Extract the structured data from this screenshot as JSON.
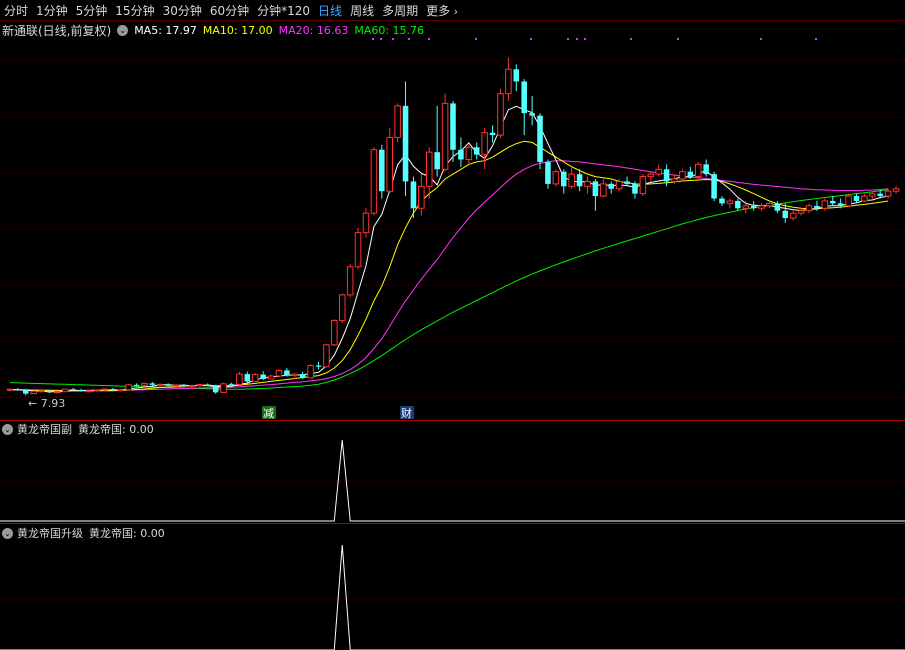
{
  "tabs": [
    {
      "label": "分时",
      "active": false
    },
    {
      "label": "1分钟",
      "active": false
    },
    {
      "label": "5分钟",
      "active": false
    },
    {
      "label": "15分钟",
      "active": false
    },
    {
      "label": "30分钟",
      "active": false
    },
    {
      "label": "60分钟",
      "active": false
    },
    {
      "label": "分钟*120",
      "active": false
    },
    {
      "label": "日线",
      "active": true
    },
    {
      "label": "周线",
      "active": false
    },
    {
      "label": "多周期",
      "active": false
    },
    {
      "label": "更多",
      "active": false
    }
  ],
  "more_icon": "chevron-right-icon",
  "stock": {
    "title": "新通联(日线,前复权)"
  },
  "ma": [
    {
      "label": "MA5: 17.97",
      "color": "#ffffff"
    },
    {
      "label": "MA10: 17.00",
      "color": "#ffff00"
    },
    {
      "label": "MA20: 16.63",
      "color": "#ff33ff"
    },
    {
      "label": "MA60: 15.76",
      "color": "#00ee00"
    }
  ],
  "markers": {
    "low_label": "← 7.93",
    "event1": "减",
    "event2": "财"
  },
  "panel2": {
    "name": "黄龙帝国副",
    "value_label": "黄龙帝国: 0.00"
  },
  "panel3": {
    "name": "黄龙帝国升级",
    "value_label": "黄龙帝国: 0.00"
  },
  "colors": {
    "up": "#ff3232",
    "down": "#54ffff",
    "ma5": "#ffffff",
    "ma10": "#ffff00",
    "ma20": "#ff33ff",
    "ma60": "#00ee00",
    "grid": "#7a0000",
    "active_tab": "#3fa6ff"
  },
  "chart_data": {
    "type": "candlestick",
    "ylim": [
      7.0,
      22.5
    ],
    "grid": "dotted",
    "ohlc": [
      [
        8.16,
        8.21,
        8.1,
        8.18
      ],
      [
        8.18,
        8.23,
        8.12,
        8.14
      ],
      [
        8.14,
        8.18,
        7.93,
        8.0
      ],
      [
        8.0,
        8.12,
        7.98,
        8.1
      ],
      [
        8.1,
        8.18,
        8.05,
        8.12
      ],
      [
        8.12,
        8.16,
        8.02,
        8.05
      ],
      [
        8.05,
        8.11,
        8.0,
        8.08
      ],
      [
        8.08,
        8.2,
        8.06,
        8.18
      ],
      [
        8.18,
        8.24,
        8.1,
        8.15
      ],
      [
        8.15,
        8.2,
        8.08,
        8.1
      ],
      [
        8.1,
        8.15,
        8.05,
        8.12
      ],
      [
        8.12,
        8.17,
        8.08,
        8.15
      ],
      [
        8.15,
        8.21,
        8.12,
        8.19
      ],
      [
        8.19,
        8.23,
        8.1,
        8.13
      ],
      [
        8.13,
        8.18,
        8.09,
        8.16
      ],
      [
        8.16,
        8.4,
        8.14,
        8.36
      ],
      [
        8.36,
        8.42,
        8.3,
        8.34
      ],
      [
        8.34,
        8.45,
        8.28,
        8.42
      ],
      [
        8.42,
        8.48,
        8.32,
        8.36
      ],
      [
        8.36,
        8.41,
        8.3,
        8.38
      ],
      [
        8.38,
        8.42,
        8.3,
        8.32
      ],
      [
        8.32,
        8.38,
        8.25,
        8.35
      ],
      [
        8.35,
        8.4,
        8.28,
        8.3
      ],
      [
        8.3,
        8.36,
        8.24,
        8.33
      ],
      [
        8.33,
        8.4,
        8.29,
        8.37
      ],
      [
        8.37,
        8.42,
        8.3,
        8.32
      ],
      [
        8.32,
        8.36,
        8.0,
        8.05
      ],
      [
        8.05,
        8.45,
        8.03,
        8.4
      ],
      [
        8.4,
        8.44,
        8.36,
        8.38
      ],
      [
        8.38,
        8.9,
        8.3,
        8.8
      ],
      [
        8.8,
        8.9,
        8.4,
        8.5
      ],
      [
        8.5,
        8.85,
        8.48,
        8.78
      ],
      [
        8.78,
        8.92,
        8.55,
        8.6
      ],
      [
        8.6,
        8.78,
        8.58,
        8.72
      ],
      [
        8.72,
        9.0,
        8.7,
        8.95
      ],
      [
        8.95,
        9.05,
        8.7,
        8.74
      ],
      [
        8.74,
        8.85,
        8.6,
        8.8
      ],
      [
        8.8,
        8.9,
        8.6,
        8.65
      ],
      [
        8.65,
        9.2,
        8.62,
        9.15
      ],
      [
        9.15,
        9.3,
        9.0,
        9.1
      ],
      [
        9.1,
        10.05,
        9.08,
        10.0
      ],
      [
        10.0,
        11.05,
        9.95,
        11.0
      ],
      [
        11.0,
        12.1,
        10.9,
        12.05
      ],
      [
        12.05,
        13.3,
        11.95,
        13.2
      ],
      [
        13.2,
        14.8,
        13.1,
        14.6
      ],
      [
        14.6,
        15.6,
        14.4,
        15.4
      ],
      [
        15.4,
        18.1,
        15.3,
        18.0
      ],
      [
        18.0,
        18.2,
        16.0,
        16.3
      ],
      [
        16.3,
        18.9,
        16.2,
        18.5
      ],
      [
        18.5,
        19.9,
        18.3,
        19.8
      ],
      [
        19.8,
        20.8,
        16.1,
        16.7
      ],
      [
        16.7,
        16.9,
        15.2,
        15.6
      ],
      [
        15.6,
        17.0,
        15.3,
        16.5
      ],
      [
        16.5,
        18.1,
        16.0,
        17.9
      ],
      [
        17.9,
        19.8,
        16.9,
        17.2
      ],
      [
        17.2,
        20.3,
        17.1,
        19.9
      ],
      [
        19.9,
        20.0,
        17.5,
        18.0
      ],
      [
        18.0,
        18.5,
        17.3,
        17.6
      ],
      [
        17.6,
        18.2,
        17.4,
        18.1
      ],
      [
        18.1,
        18.3,
        17.6,
        17.8
      ],
      [
        17.8,
        18.9,
        17.2,
        18.7
      ],
      [
        18.7,
        19.0,
        18.3,
        18.6
      ],
      [
        18.6,
        20.5,
        18.5,
        20.3
      ],
      [
        20.3,
        21.8,
        20.0,
        21.3
      ],
      [
        21.3,
        21.5,
        20.4,
        20.8
      ],
      [
        20.8,
        20.9,
        18.6,
        19.5
      ],
      [
        19.5,
        20.2,
        19.0,
        19.4
      ],
      [
        19.4,
        19.5,
        17.2,
        17.5
      ],
      [
        17.5,
        17.6,
        16.4,
        16.6
      ],
      [
        16.6,
        17.2,
        16.5,
        17.1
      ],
      [
        17.1,
        17.2,
        16.2,
        16.5
      ],
      [
        16.5,
        17.3,
        16.4,
        17.0
      ],
      [
        17.0,
        17.2,
        16.3,
        16.5
      ],
      [
        16.5,
        16.9,
        16.2,
        16.7
      ],
      [
        16.7,
        16.8,
        15.5,
        16.1
      ],
      [
        16.1,
        16.8,
        16.05,
        16.6
      ],
      [
        16.6,
        16.7,
        16.2,
        16.4
      ],
      [
        16.4,
        16.8,
        16.3,
        16.7
      ],
      [
        16.7,
        16.9,
        16.5,
        16.6
      ],
      [
        16.6,
        16.7,
        16.0,
        16.2
      ],
      [
        16.2,
        17.0,
        16.1,
        16.9
      ],
      [
        16.9,
        17.1,
        16.7,
        17.0
      ],
      [
        17.0,
        17.4,
        16.9,
        17.2
      ],
      [
        17.2,
        17.4,
        16.5,
        16.7
      ],
      [
        16.7,
        17.0,
        16.6,
        16.8
      ],
      [
        16.8,
        17.2,
        16.7,
        17.1
      ],
      [
        17.1,
        17.3,
        16.8,
        16.9
      ],
      [
        16.9,
        17.5,
        16.8,
        17.4
      ],
      [
        17.4,
        17.6,
        16.9,
        17.0
      ],
      [
        17.0,
        17.1,
        15.9,
        16.0
      ],
      [
        16.0,
        16.1,
        15.7,
        15.8
      ],
      [
        15.8,
        16.0,
        15.6,
        15.9
      ],
      [
        15.9,
        16.0,
        15.5,
        15.6
      ],
      [
        15.6,
        15.9,
        15.4,
        15.7
      ],
      [
        15.7,
        15.9,
        15.5,
        15.6
      ],
      [
        15.6,
        15.8,
        15.5,
        15.7
      ],
      [
        15.7,
        15.9,
        15.6,
        15.8
      ],
      [
        15.8,
        15.9,
        15.4,
        15.5
      ],
      [
        15.5,
        15.8,
        15.0,
        15.2
      ],
      [
        15.2,
        15.5,
        15.1,
        15.4
      ],
      [
        15.4,
        15.6,
        15.3,
        15.5
      ],
      [
        15.5,
        15.8,
        15.4,
        15.7
      ],
      [
        15.7,
        15.9,
        15.5,
        15.6
      ],
      [
        15.6,
        16.0,
        15.5,
        15.9
      ],
      [
        15.9,
        16.1,
        15.7,
        15.8
      ],
      [
        15.8,
        16.0,
        15.6,
        15.7
      ],
      [
        15.7,
        16.2,
        15.65,
        16.1
      ],
      [
        16.1,
        16.2,
        15.8,
        15.9
      ],
      [
        15.9,
        16.2,
        15.85,
        16.1
      ],
      [
        16.1,
        16.3,
        15.95,
        16.2
      ],
      [
        16.2,
        16.35,
        16.0,
        16.1
      ],
      [
        16.1,
        16.4,
        16.0,
        16.3
      ],
      [
        16.3,
        16.5,
        16.2,
        16.4
      ]
    ],
    "ma5": [
      8.16,
      8.16,
      8.14,
      8.12,
      8.1,
      8.08,
      8.08,
      8.1,
      8.12,
      8.12,
      8.13,
      8.14,
      8.15,
      8.15,
      8.15,
      8.2,
      8.23,
      8.27,
      8.3,
      8.37,
      8.36,
      8.35,
      8.34,
      8.33,
      8.33,
      8.33,
      8.28,
      8.29,
      8.3,
      8.39,
      8.43,
      8.57,
      8.64,
      8.69,
      8.71,
      8.76,
      8.76,
      8.77,
      8.82,
      8.87,
      9.14,
      9.58,
      10.26,
      11.07,
      12.17,
      13.25,
      14.85,
      15.35,
      16.33,
      17.38,
      17.8,
      17.32,
      17.03,
      16.9,
      16.56,
      17.33,
      17.72,
      17.95,
      18.28,
      17.88,
      17.64,
      18.16,
      18.92,
      19.64,
      19.78,
      19.64,
      19.52,
      18.96,
      18.26,
      17.59,
      16.86,
      16.73,
      16.66,
      16.71,
      16.53,
      16.58,
      16.52,
      16.56,
      16.53,
      16.46,
      16.58,
      16.66,
      16.72,
      16.78,
      16.8,
      16.91,
      16.86,
      17.05,
      17.12,
      16.88,
      16.64,
      16.38,
      16.05,
      15.8,
      15.72,
      15.71,
      15.71,
      15.64,
      15.6,
      15.54,
      15.51,
      15.56,
      15.57,
      15.68,
      15.7,
      15.71,
      15.78,
      15.82,
      15.92,
      15.94,
      16.04,
      16.1
    ],
    "ma10": [
      8.16,
      8.16,
      8.15,
      8.14,
      8.13,
      8.12,
      8.12,
      8.12,
      8.12,
      8.12,
      8.12,
      8.12,
      8.12,
      8.12,
      8.13,
      8.15,
      8.17,
      8.19,
      8.22,
      8.25,
      8.27,
      8.29,
      8.31,
      8.33,
      8.34,
      8.35,
      8.32,
      8.32,
      8.32,
      8.35,
      8.38,
      8.42,
      8.46,
      8.5,
      8.54,
      8.58,
      8.62,
      8.66,
      8.7,
      8.74,
      8.85,
      9.05,
      9.35,
      9.8,
      10.4,
      11.05,
      11.8,
      12.4,
      13.2,
      14.1,
      14.8,
      15.4,
      15.9,
      16.2,
      16.45,
      16.8,
      17.0,
      17.2,
      17.4,
      17.5,
      17.55,
      17.7,
      17.9,
      18.1,
      18.25,
      18.35,
      18.3,
      18.1,
      17.9,
      17.7,
      17.5,
      17.3,
      17.15,
      17.0,
      16.9,
      16.85,
      16.8,
      16.7,
      16.65,
      16.6,
      16.58,
      16.6,
      16.62,
      16.65,
      16.68,
      16.72,
      16.74,
      16.76,
      16.78,
      16.76,
      16.7,
      16.6,
      16.48,
      16.35,
      16.2,
      16.05,
      15.9,
      15.78,
      15.7,
      15.64,
      15.6,
      15.58,
      15.58,
      15.6,
      15.62,
      15.65,
      15.68,
      15.72,
      15.76,
      15.8,
      15.85,
      15.9
    ],
    "ma20": [
      8.16,
      8.16,
      8.16,
      8.15,
      8.15,
      8.15,
      8.14,
      8.14,
      8.14,
      8.14,
      8.14,
      8.14,
      8.14,
      8.14,
      8.14,
      8.15,
      8.15,
      8.16,
      8.17,
      8.18,
      8.19,
      8.2,
      8.21,
      8.22,
      8.23,
      8.24,
      8.24,
      8.25,
      8.26,
      8.28,
      8.3,
      8.32,
      8.35,
      8.37,
      8.4,
      8.43,
      8.46,
      8.49,
      8.52,
      8.56,
      8.62,
      8.7,
      8.82,
      8.98,
      9.2,
      9.48,
      9.85,
      10.25,
      10.75,
      11.3,
      11.8,
      12.25,
      12.7,
      13.1,
      13.5,
      13.95,
      14.4,
      14.8,
      15.2,
      15.55,
      15.85,
      16.15,
      16.45,
      16.75,
      17.0,
      17.2,
      17.35,
      17.45,
      17.5,
      17.55,
      17.55,
      17.52,
      17.5,
      17.46,
      17.42,
      17.38,
      17.34,
      17.3,
      17.25,
      17.2,
      17.15,
      17.1,
      17.05,
      17.0,
      16.96,
      16.92,
      16.88,
      16.85,
      16.82,
      16.78,
      16.74,
      16.7,
      16.66,
      16.62,
      16.58,
      16.55,
      16.52,
      16.49,
      16.46,
      16.43,
      16.4,
      16.38,
      16.36,
      16.35,
      16.34,
      16.33,
      16.33,
      16.33,
      16.34,
      16.35,
      16.37,
      16.4
    ],
    "ma60": [
      8.45,
      8.44,
      8.43,
      8.42,
      8.41,
      8.4,
      8.39,
      8.38,
      8.37,
      8.36,
      8.35,
      8.34,
      8.33,
      8.32,
      8.31,
      8.3,
      8.29,
      8.28,
      8.27,
      8.26,
      8.25,
      8.24,
      8.23,
      8.22,
      8.21,
      8.2,
      8.19,
      8.18,
      8.18,
      8.18,
      8.19,
      8.2,
      8.21,
      8.23,
      8.25,
      8.27,
      8.29,
      8.31,
      8.34,
      8.38,
      8.46,
      8.56,
      8.68,
      8.82,
      8.98,
      9.16,
      9.36,
      9.56,
      9.78,
      10.0,
      10.22,
      10.42,
      10.62,
      10.8,
      10.98,
      11.16,
      11.34,
      11.5,
      11.66,
      11.82,
      11.98,
      12.14,
      12.3,
      12.46,
      12.62,
      12.76,
      12.9,
      13.03,
      13.16,
      13.28,
      13.4,
      13.52,
      13.63,
      13.74,
      13.85,
      13.96,
      14.06,
      14.16,
      14.26,
      14.36,
      14.46,
      14.56,
      14.66,
      14.76,
      14.86,
      14.96,
      15.05,
      15.14,
      15.22,
      15.3,
      15.37,
      15.44,
      15.51,
      15.57,
      15.62,
      15.67,
      15.72,
      15.77,
      15.82,
      15.87,
      15.92,
      15.96,
      16.0,
      16.04,
      16.08,
      16.12,
      16.16,
      16.2,
      16.24,
      16.28,
      16.32,
      16.36
    ],
    "panel2_values": {
      "peak_index": 42,
      "peak": 1,
      "base": 0
    },
    "panel3_values": {
      "peak_index": 42,
      "peak": 1,
      "base": 0
    }
  }
}
